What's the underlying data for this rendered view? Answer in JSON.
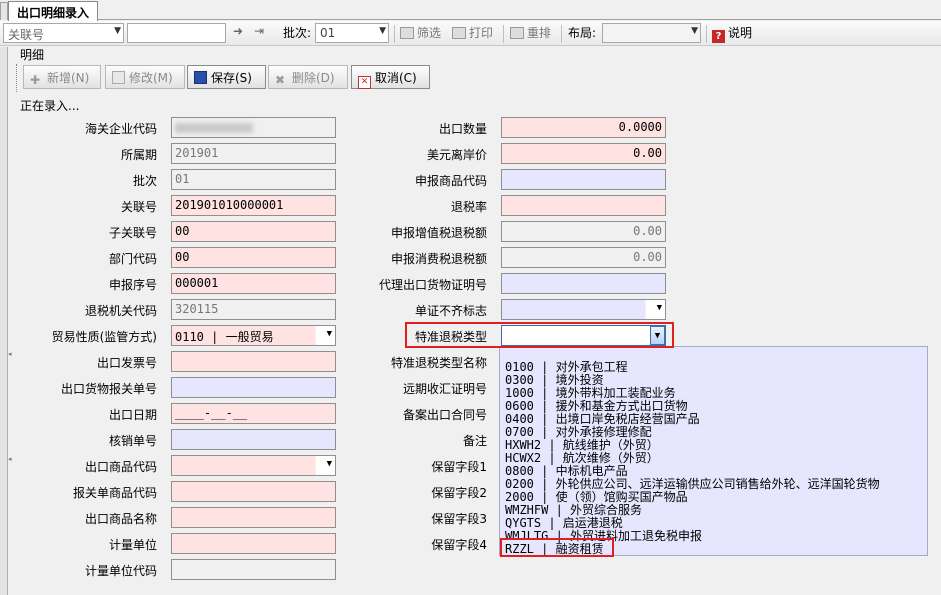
{
  "tab": {
    "title": "出口明细录入"
  },
  "toolbar": {
    "field_select": "关联号",
    "search_value": "",
    "batch_label": "批次:",
    "batch_value": "01",
    "filter": "筛选",
    "print": "打印",
    "resort": "重排",
    "layout_label": "布局:",
    "layout_value": "",
    "help": "说明"
  },
  "group_title": "明细",
  "actions": {
    "add": "新增(N)",
    "edit": "修改(M)",
    "save": "保存(S)",
    "delete": "删除(D)",
    "cancel": "取消(C)"
  },
  "status": "正在录入...",
  "left_fields": [
    {
      "label": "海关企业代码",
      "value": ""
    },
    {
      "label": "所属期",
      "value": "201901"
    },
    {
      "label": "批次",
      "value": "01"
    },
    {
      "label": "关联号",
      "value": "201901010000001"
    },
    {
      "label": "子关联号",
      "value": "00"
    },
    {
      "label": "部门代码",
      "value": "00"
    },
    {
      "label": "申报序号",
      "value": "000001"
    },
    {
      "label": "退税机关代码",
      "value": "320115"
    },
    {
      "label": "贸易性质(监管方式)",
      "value": "0110 | 一般贸易"
    },
    {
      "label": "出口发票号",
      "value": ""
    },
    {
      "label": "出口货物报关单号",
      "value": ""
    },
    {
      "label": "出口日期",
      "value": "____-__-__"
    },
    {
      "label": "核销单号",
      "value": ""
    },
    {
      "label": "出口商品代码",
      "value": ""
    },
    {
      "label": "报关单商品代码",
      "value": ""
    },
    {
      "label": "出口商品名称",
      "value": ""
    },
    {
      "label": "计量单位",
      "value": ""
    },
    {
      "label": "计量单位代码",
      "value": ""
    }
  ],
  "right_fields": [
    {
      "label": "出口数量",
      "value": "0.0000"
    },
    {
      "label": "美元离岸价",
      "value": "0.00"
    },
    {
      "label": "申报商品代码",
      "value": ""
    },
    {
      "label": "退税率",
      "value": ""
    },
    {
      "label": "申报增值税退税额",
      "value": "0.00"
    },
    {
      "label": "申报消费税退税额",
      "value": "0.00"
    },
    {
      "label": "代理出口货物证明号",
      "value": ""
    },
    {
      "label": "单证不齐标志",
      "value": ""
    },
    {
      "label": "特准退税类型",
      "value": ""
    },
    {
      "label": "特准退税类型名称",
      "value": ""
    },
    {
      "label": "远期收汇证明号",
      "value": ""
    },
    {
      "label": "备案出口合同号",
      "value": ""
    },
    {
      "label": "备注",
      "value": ""
    },
    {
      "label": "保留字段1",
      "value": ""
    },
    {
      "label": "保留字段2",
      "value": ""
    },
    {
      "label": "保留字段3",
      "value": ""
    },
    {
      "label": "保留字段4",
      "value": ""
    }
  ],
  "dropdown_options": [
    "0100 | 对外承包工程",
    "0300 | 境外投资",
    "1000 | 境外带料加工装配业务",
    "0600 | 援外和基金方式出口货物",
    "0400 | 出境口岸免税店经营国产品",
    "0700 | 对外承接修理修配",
    "HXWH2 | 航线维护（外贸）",
    "HCWX2 | 航次维修（外贸）",
    "0800 | 中标机电产品",
    "0200 | 外轮供应公司、远洋运输供应公司销售给外轮、远洋国轮货物",
    "2000 | 使（领）馆购买国产物品",
    "WMZHFW | 外贸综合服务",
    "QYGTS | 启运港退税",
    "WMJLTG | 外贸进料加工退免税申报",
    "RZZL | 融资租赁"
  ],
  "colors": {
    "required": "#ffe2e2",
    "lookup": "#e6e6ff",
    "highlight": "#e02020"
  }
}
